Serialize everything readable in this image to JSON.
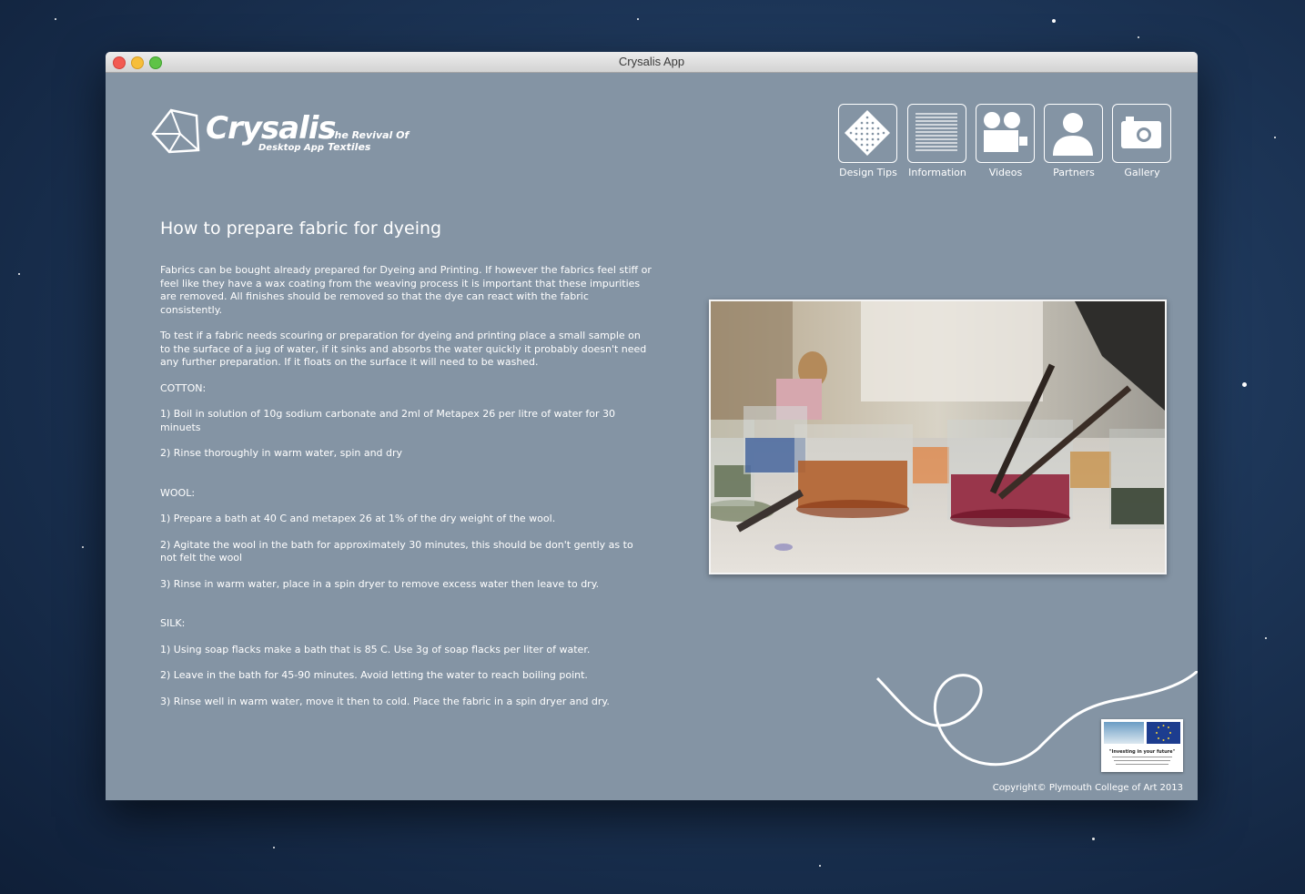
{
  "window": {
    "title": "Crysalis App"
  },
  "logo": {
    "brand": "Crysalis",
    "subtitle": "Desktop App",
    "tagline": "The Revival Of Textiles"
  },
  "nav": [
    {
      "label": "Design Tips",
      "icon": "grid-pattern-icon"
    },
    {
      "label": "Information",
      "icon": "lines-icon"
    },
    {
      "label": "Videos",
      "icon": "video-camera-icon"
    },
    {
      "label": "Partners",
      "icon": "person-icon"
    },
    {
      "label": "Gallery",
      "icon": "camera-icon"
    }
  ],
  "article": {
    "heading": "How to prepare fabric for dyeing",
    "intro": "Fabrics can be bought already prepared for Dyeing and Printing.  If however the fabrics feel stiff or feel like they have a wax coating from the weaving process it is important that these impurities are removed.  All finishes should be removed so that the dye can react with the fabric consistently.",
    "test": "To test if a fabric needs scouring or preparation for dyeing and printing place a small sample on to the surface of a jug of water, if it sinks and absorbs the water quickly it probably doesn't need any further preparation.  If it floats on the surface it will need to be washed.",
    "cotton": {
      "title": "COTTON:",
      "steps": [
        "1) Boil in solution of 10g sodium carbonate and 2ml of Metapex 26 per litre  of water for 30 minuets",
        "2) Rinse thoroughly in warm water, spin and dry"
      ]
    },
    "wool": {
      "title": "WOOL:",
      "steps": [
        "1) Prepare a bath at 40 C and metapex 26 at 1% of the dry weight of the wool.",
        "2) Agitate the wool in the bath for approximately 30 minutes, this should be don't gently as to not felt the wool",
        "3) Rinse in warm water, place in a spin dryer to remove excess water then leave to dry."
      ]
    },
    "silk": {
      "title": "SILK:",
      "steps": [
        "1) Using soap flacks make a bath that is 85 C. Use 3g of soap flacks per liter of water.",
        "2) Leave in the bath for 45-90 minutes. Avoid letting the water to reach boiling point.",
        "3) Rinse well in warm water, move it then to cold.  Place the fabric in a spin dryer and dry."
      ]
    }
  },
  "badge": {
    "tagline": "\"Investing in your future\""
  },
  "footer": {
    "copyright": "Copyright© Plymouth College of Art 2013"
  }
}
